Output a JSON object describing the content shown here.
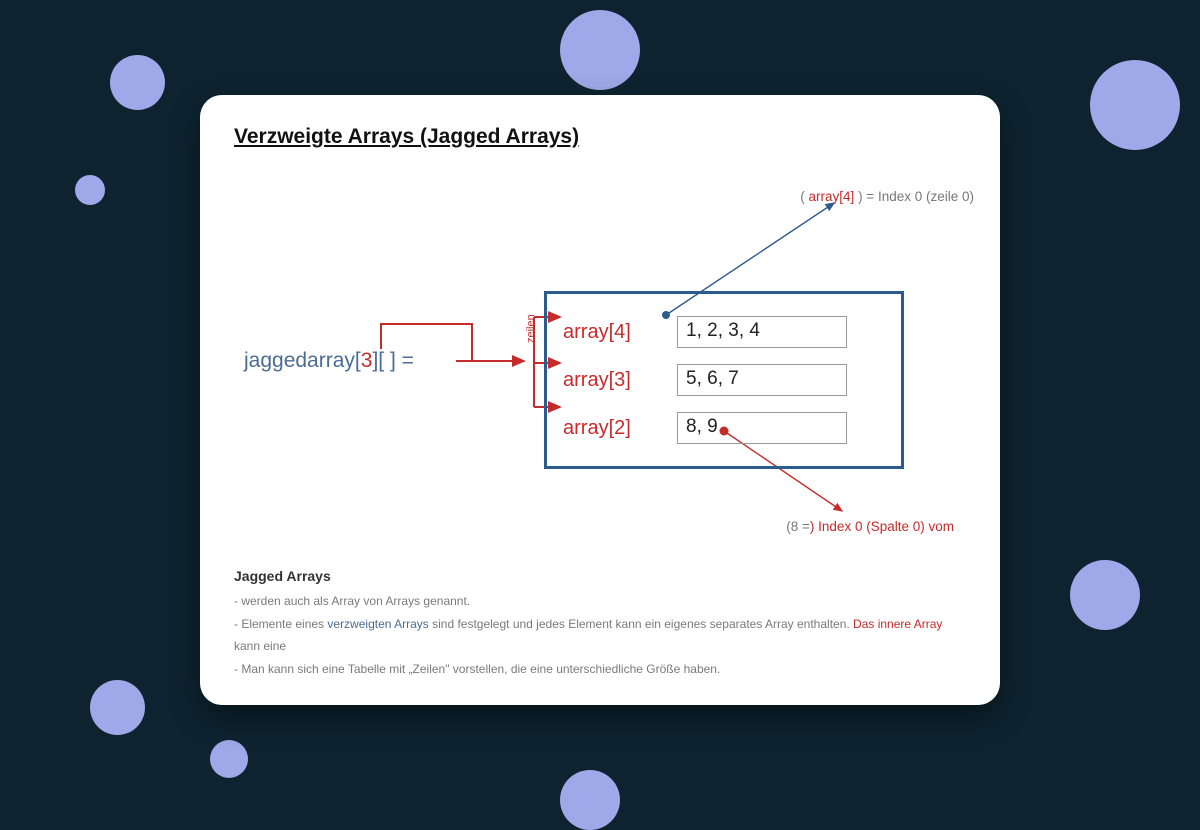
{
  "title": "Verzweigte Arrays (Jagged Arrays)",
  "jagged": {
    "before": "jaggedarray[",
    "num": "3",
    "after": "][ ] ="
  },
  "zeilen_label": "zeilen",
  "inner": [
    {
      "label": "array[4]",
      "values": "1, 2, 3, 4"
    },
    {
      "label": "array[3]",
      "values": "5, 6, 7"
    },
    {
      "label": "array[2]",
      "values": "8, 9"
    }
  ],
  "callout_top": {
    "open": "( ",
    "red": "array[4]",
    "rest": " ) = Index 0 (zeile 0)"
  },
  "callout_bot": {
    "open": "(8 =",
    "rest_red": ") Index 0 (Spalte 0) vom"
  },
  "notes": {
    "heading": "Jagged Arrays",
    "line1": "- werden auch als Array von Arrays genannt.",
    "line2a": "- Elemente eines ",
    "line2_blue": "verzweigten Arrays",
    "line2b": " sind festgelegt und jedes Element kann ein eigenes separates Array enthalten. ",
    "line2_red": "Das innere Array",
    "line2c": " kann eine",
    "line3": "- Man kann sich eine Tabelle mit „Zeilen\" vorstellen, die eine unterschiedliche Größe haben."
  },
  "colors": {
    "blue": "#2c5b8f",
    "red": "#c62b2b",
    "slate": "#4b6c94"
  }
}
